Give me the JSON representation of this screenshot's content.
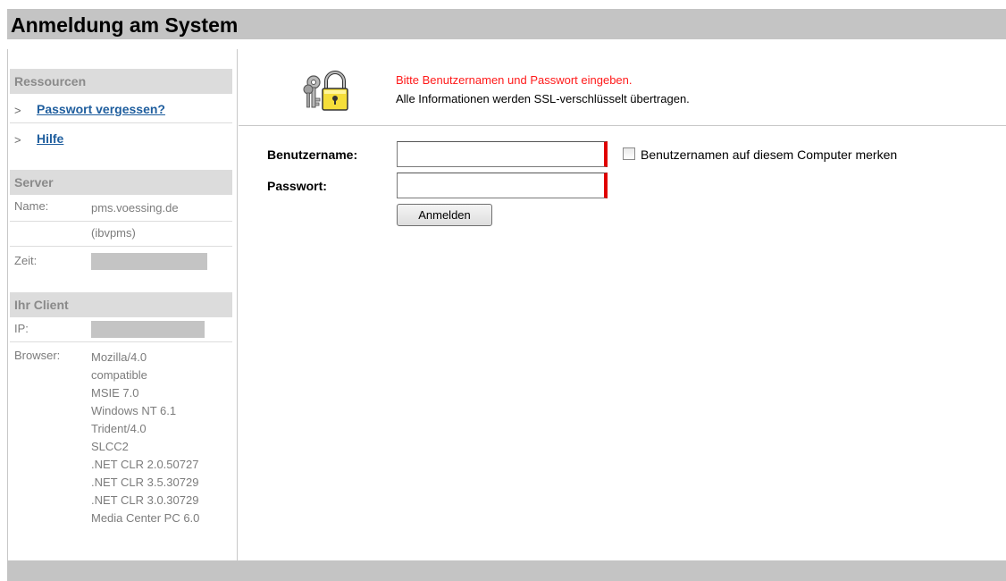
{
  "header": {
    "title": "Anmeldung am System"
  },
  "sidebar": {
    "resources": {
      "heading": "Ressourcen",
      "items": [
        {
          "arrow": ">",
          "label": "Passwort vergessen?"
        },
        {
          "arrow": ">",
          "label": "Hilfe"
        }
      ]
    },
    "server": {
      "heading": "Server",
      "name_label": "Name:",
      "name_value": "pms.voessing.de",
      "name_alias": "(ibvpms)",
      "time_label": "Zeit:"
    },
    "client": {
      "heading": "Ihr Client",
      "ip_label": "IP:",
      "browser_label": "Browser:",
      "browser_lines": [
        "Mozilla/4.0",
        "compatible",
        "MSIE 7.0",
        "Windows NT 6.1",
        "Trident/4.0",
        "SLCC2",
        ".NET CLR 2.0.50727",
        ".NET CLR 3.5.30729",
        ".NET CLR 3.0.30729",
        "Media Center PC 6.0"
      ]
    }
  },
  "main": {
    "icon": "lock-with-keys-icon",
    "message_warning": "Bitte Benutzernamen und Passwort eingeben.",
    "message_info": "Alle Informationen werden SSL-verschlüsselt übertragen.",
    "username_label": "Benutzername:",
    "username_value": "",
    "password_label": "Passwort:",
    "password_value": "",
    "remember_label": "Benutzernamen auf diesem Computer merken",
    "remember_checked": false,
    "login_button": "Anmelden"
  },
  "colors": {
    "header_bg": "#c4c4c4",
    "section_bg": "#dcdcdc",
    "link": "#1f5e9e",
    "warning": "#ff1a1a",
    "required_marker": "#e00000"
  }
}
